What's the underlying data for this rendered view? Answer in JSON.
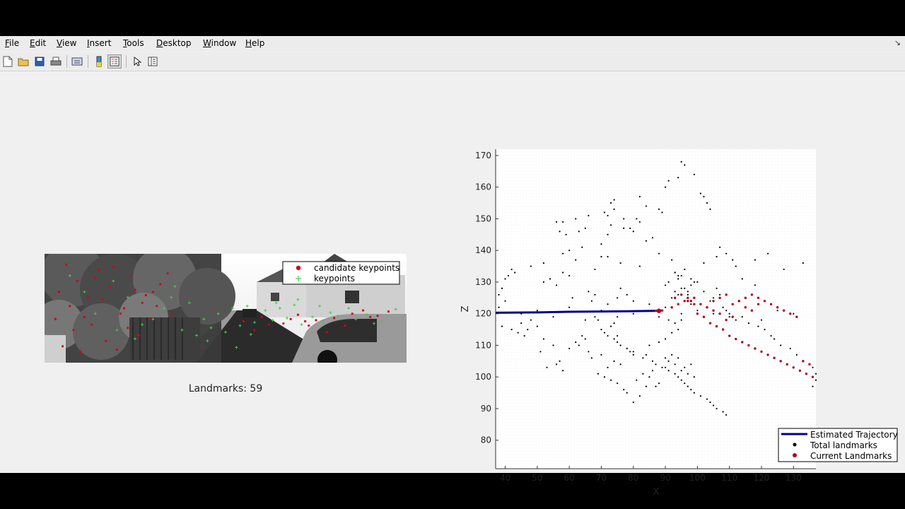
{
  "menu": [
    {
      "accel": "F",
      "rest": "ile"
    },
    {
      "accel": "E",
      "rest": "dit"
    },
    {
      "accel": "V",
      "rest": "iew"
    },
    {
      "accel": "I",
      "rest": "nsert"
    },
    {
      "accel": "T",
      "rest": "ools"
    },
    {
      "accel": "D",
      "rest": "esktop"
    },
    {
      "accel": "W",
      "rest": "indow"
    },
    {
      "accel": "H",
      "rest": "elp"
    }
  ],
  "toolbar_icons": [
    "new-figure-icon",
    "open-file-icon",
    "save-icon",
    "print-icon",
    "print-figure-icon",
    "colorbar-icon",
    "legend-icon",
    "pointer-icon",
    "property-editor-icon"
  ],
  "image_panel": {
    "legend": [
      "candidate keypoints",
      "keypoints"
    ],
    "landmarks_text": "Landmarks: 59"
  },
  "colors": {
    "trajectory": "#00008b",
    "total_landmarks": "#000000",
    "current_landmarks": "#b00020",
    "candidate_keypoints": "#d0021b",
    "keypoints": "#3ecf3e"
  },
  "chart_data": {
    "type": "scatter",
    "xlabel": "X",
    "ylabel": "Z",
    "xlim": [
      37,
      137
    ],
    "ylim": [
      71,
      172
    ],
    "xticks": [
      40,
      50,
      60,
      70,
      80,
      90,
      100,
      110,
      120,
      130
    ],
    "yticks": [
      80,
      90,
      100,
      110,
      120,
      130,
      140,
      150,
      160,
      170
    ],
    "grid": "minor dotted",
    "legend_position": "bottom-right",
    "series": [
      {
        "name": "Estimated Trajectory",
        "kind": "line",
        "x": [
          37,
          50,
          60,
          70,
          80,
          88
        ],
        "y": [
          120.3,
          120.4,
          120.6,
          120.7,
          120.8,
          120.9
        ]
      },
      {
        "name": "Total landmarks",
        "kind": "points",
        "x": [
          38,
          39,
          40,
          41,
          42,
          43,
          38,
          40,
          39,
          42,
          44,
          46,
          45,
          48,
          50,
          47,
          52,
          55,
          51,
          57,
          53,
          58,
          56,
          60,
          62,
          64,
          66,
          65,
          63,
          67,
          70,
          72,
          71,
          69,
          74,
          76,
          73,
          75,
          78,
          77,
          80,
          82,
          84,
          81,
          83,
          86,
          85,
          88,
          87,
          89,
          90,
          91,
          92,
          93,
          94,
          95,
          96,
          97,
          98,
          99,
          92,
          93,
          94,
          95,
          96,
          97,
          98,
          90,
          91,
          94,
          96,
          97,
          93,
          95,
          98,
          100,
          102,
          105,
          104,
          106,
          107,
          108,
          109,
          110,
          112,
          114,
          116,
          119,
          121,
          123,
          124,
          126,
          129,
          131,
          133,
          135,
          136,
          137,
          137,
          136,
          52,
          54,
          56,
          58,
          60,
          61,
          66,
          67,
          68,
          72,
          75,
          76,
          78,
          80,
          73,
          77,
          81,
          56,
          57,
          59,
          62,
          63,
          65,
          66,
          58,
          60,
          64,
          70,
          71,
          72,
          74,
          77,
          79,
          80,
          82,
          84,
          86,
          70,
          72,
          73,
          74,
          82,
          84,
          88,
          89,
          90,
          91,
          94,
          95,
          96,
          99,
          101,
          102,
          103,
          104,
          107,
          109,
          111,
          114,
          118,
          93,
          94,
          96,
          98,
          99,
          86,
          88,
          91,
          93,
          95,
          70,
          71,
          72,
          73,
          74,
          75,
          76,
          78,
          79,
          80,
          83,
          85,
          88,
          90,
          92,
          94,
          68,
          69,
          74,
          75,
          78,
          80,
          84,
          86,
          87,
          90,
          91,
          93,
          94,
          95,
          96,
          97,
          98,
          99,
          101,
          103,
          104,
          105,
          106,
          108,
          109,
          45,
          50,
          55,
          60,
          65,
          70,
          75,
          80,
          85,
          90,
          95,
          100,
          105,
          110,
          115,
          120,
          125,
          130,
          48,
          52,
          58,
          62,
          68,
          72,
          76,
          82,
          88,
          92,
          96,
          102,
          106,
          112,
          118,
          122,
          127,
          133
        ],
        "y": [
          122,
          128,
          131,
          132,
          134,
          133,
          126,
          124,
          116,
          115,
          114,
          113,
          117,
          118,
          116,
          115,
          112,
          110,
          108,
          105,
          103,
          102,
          104,
          109,
          111,
          113,
          108,
          112,
          110,
          106,
          107,
          103,
          100,
          101,
          105,
          104,
          99,
          98,
          95,
          96,
          92,
          94,
          97,
          99,
          101,
          102,
          100,
          98,
          97,
          103,
          106,
          105,
          107,
          104,
          106,
          102,
          103,
          101,
          104,
          100,
          125,
          127,
          126,
          128,
          124,
          126,
          123,
          129,
          130,
          131,
          128,
          127,
          133,
          132,
          129,
          130,
          127,
          125,
          124,
          128,
          126,
          122,
          121,
          120,
          118,
          119,
          117,
          116,
          115,
          113,
          112,
          110,
          109,
          107,
          105,
          104,
          103,
          101,
          99,
          97,
          130,
          131,
          129,
          133,
          132,
          125,
          127,
          124,
          126,
          123,
          125,
          128,
          126,
          124,
          148,
          147,
          150,
          149,
          146,
          145,
          150,
          146,
          147,
          151,
          149,
          140,
          141,
          138,
          152,
          151,
          153,
          150,
          147,
          146,
          149,
          143,
          144,
          142,
          145,
          155,
          156,
          157,
          154,
          153,
          152,
          160,
          162,
          163,
          168,
          167,
          164,
          158,
          157,
          155,
          153,
          141,
          139,
          137,
          131,
          129,
          133,
          132,
          134,
          131,
          130,
          121,
          119,
          118,
          117,
          120,
          115,
          114,
          113,
          116,
          112,
          111,
          110,
          109,
          108,
          107,
          106,
          110,
          111,
          112,
          114,
          115,
          119,
          118,
          117,
          113,
          109,
          108,
          107,
          105,
          104,
          103,
          102,
          101,
          100,
          99,
          98,
          97,
          96,
          95,
          94,
          93,
          92,
          91,
          90,
          89,
          88,
          120,
          121,
          119,
          122,
          118,
          121,
          119,
          120,
          123,
          122,
          118,
          121,
          120,
          119,
          122,
          118,
          121,
          120,
          135,
          136,
          139,
          137,
          134,
          138,
          136,
          135,
          139,
          137,
          134,
          136,
          138,
          135,
          137,
          139,
          134,
          136
        ]
      },
      {
        "name": "Current Landmarks",
        "kind": "points",
        "x": [
          87,
          89,
          92,
          94,
          96,
          97,
          98,
          99,
          100,
          102,
          104,
          106,
          108,
          110,
          112,
          114,
          116,
          118,
          120,
          122,
          124,
          126,
          128,
          130,
          132,
          134,
          136,
          105,
          107,
          109,
          111,
          113,
          115,
          117,
          119,
          121,
          123,
          125,
          127,
          129,
          131,
          133,
          135,
          93,
          95,
          97,
          99,
          101,
          103,
          105,
          107,
          109,
          111,
          113,
          115,
          117,
          119
        ],
        "y": [
          120.9,
          121,
          122,
          123,
          124,
          125,
          124,
          123,
          120,
          119,
          117,
          116,
          115,
          113,
          112,
          111,
          110,
          109,
          108,
          107,
          106,
          105,
          104,
          103,
          102,
          101,
          100,
          124,
          125,
          126,
          123,
          124,
          125,
          126,
          125,
          124,
          123,
          122,
          121,
          120,
          119,
          105,
          104,
          125,
          126,
          124,
          125,
          123,
          122,
          121,
          120,
          118,
          119,
          124,
          122,
          121,
          123
        ]
      }
    ]
  },
  "image_points": {
    "candidate_keypoints": {
      "x": [
        0.06,
        0.09,
        0.12,
        0.15,
        0.18,
        0.21,
        0.24,
        0.27,
        0.3,
        0.03,
        0.08,
        0.13,
        0.17,
        0.22,
        0.26,
        0.29,
        0.05,
        0.1,
        0.14,
        0.19,
        0.23,
        0.28,
        0.32,
        0.35,
        0.55,
        0.6,
        0.62,
        0.68,
        0.7,
        0.72,
        0.75,
        0.8,
        0.85,
        0.88,
        0.92,
        0.95,
        0.04,
        0.07,
        0.11,
        0.16,
        0.2,
        0.25,
        0.31,
        0.34,
        0.58,
        0.66,
        0.73,
        0.78,
        0.83,
        0.9
      ],
      "y": [
        0.1,
        0.25,
        0.4,
        0.15,
        0.3,
        0.55,
        0.2,
        0.45,
        0.35,
        0.6,
        0.7,
        0.65,
        0.8,
        0.5,
        0.75,
        0.6,
        0.85,
        0.9,
        0.22,
        0.12,
        0.68,
        0.38,
        0.28,
        0.55,
        0.62,
        0.58,
        0.65,
        0.6,
        0.56,
        0.62,
        0.61,
        0.59,
        0.55,
        0.52,
        0.57,
        0.53,
        0.35,
        0.48,
        0.58,
        0.42,
        0.88,
        0.33,
        0.48,
        0.18,
        0.7,
        0.64,
        0.66,
        0.72,
        0.66,
        0.58
      ]
    },
    "keypoints": {
      "x": [
        0.07,
        0.11,
        0.14,
        0.19,
        0.23,
        0.27,
        0.33,
        0.36,
        0.4,
        0.44,
        0.48,
        0.52,
        0.56,
        0.61,
        0.65,
        0.69,
        0.74,
        0.79,
        0.84,
        0.89,
        0.93,
        0.97,
        0.38,
        0.42,
        0.46,
        0.5,
        0.54,
        0.58,
        0.63,
        0.67,
        0.71,
        0.77,
        0.81,
        0.86,
        0.91,
        0.2,
        0.25,
        0.3,
        0.35,
        0.45,
        0.53,
        0.57,
        0.64,
        0.7,
        0.76
      ],
      "y": [
        0.2,
        0.35,
        0.55,
        0.25,
        0.4,
        0.65,
        0.5,
        0.3,
        0.45,
        0.6,
        0.55,
        0.5,
        0.48,
        0.52,
        0.5,
        0.47,
        0.58,
        0.54,
        0.5,
        0.56,
        0.62,
        0.51,
        0.7,
        0.75,
        0.68,
        0.72,
        0.66,
        0.63,
        0.61,
        0.59,
        0.65,
        0.62,
        0.57,
        0.6,
        0.64,
        0.7,
        0.78,
        0.6,
        0.4,
        0.8,
        0.86,
        0.74,
        0.45,
        0.42,
        0.48
      ]
    }
  }
}
